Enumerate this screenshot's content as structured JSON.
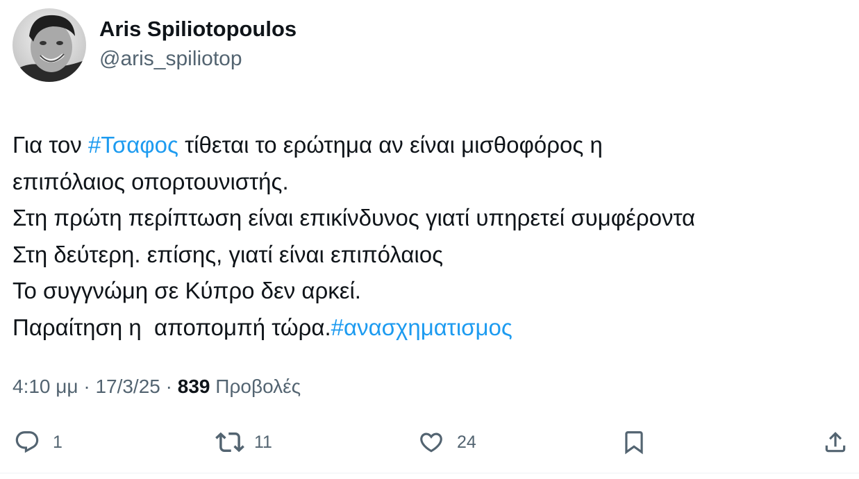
{
  "author": {
    "display_name": "Aris Spiliotopoulos",
    "handle": "@aris_spiliotop",
    "avatar_icon": "profile-photo"
  },
  "tweet": {
    "lines": [
      [
        {
          "text": "Για τον "
        },
        {
          "text": "#Τσαφος",
          "hashtag": true
        },
        {
          "text": " τίθεται το ερώτημα αν είναι μισθοφόρος η"
        }
      ],
      [
        {
          "text": "επιπόλαιος οπορτουνιστής."
        }
      ],
      [
        {
          "text": "Στη πρώτη περίπτωση είναι επικίνδυνος γιατί υπηρετεί συμφέροντα"
        }
      ],
      [
        {
          "text": "Στη δεύτερη. επίσης, γιατί είναι επιπόλαιος"
        }
      ],
      [
        {
          "text": "Το συγγνώμη σε Κύπρο δεν αρκεί."
        }
      ],
      [
        {
          "text": "Παραίτηση η  αποπομπή τώρα."
        },
        {
          "text": "#ανασχηματισμος",
          "hashtag": true
        }
      ]
    ]
  },
  "meta": {
    "time": "4:10 μμ",
    "separator": " · ",
    "date": "17/3/25",
    "views_count": "839",
    "views_label": "Προβολές"
  },
  "actions": {
    "reply_count": "1",
    "retweet_count": "11",
    "like_count": "24"
  },
  "colors": {
    "text": "#0f1419",
    "secondary": "#536471",
    "hashtag": "#1d9bf0"
  }
}
